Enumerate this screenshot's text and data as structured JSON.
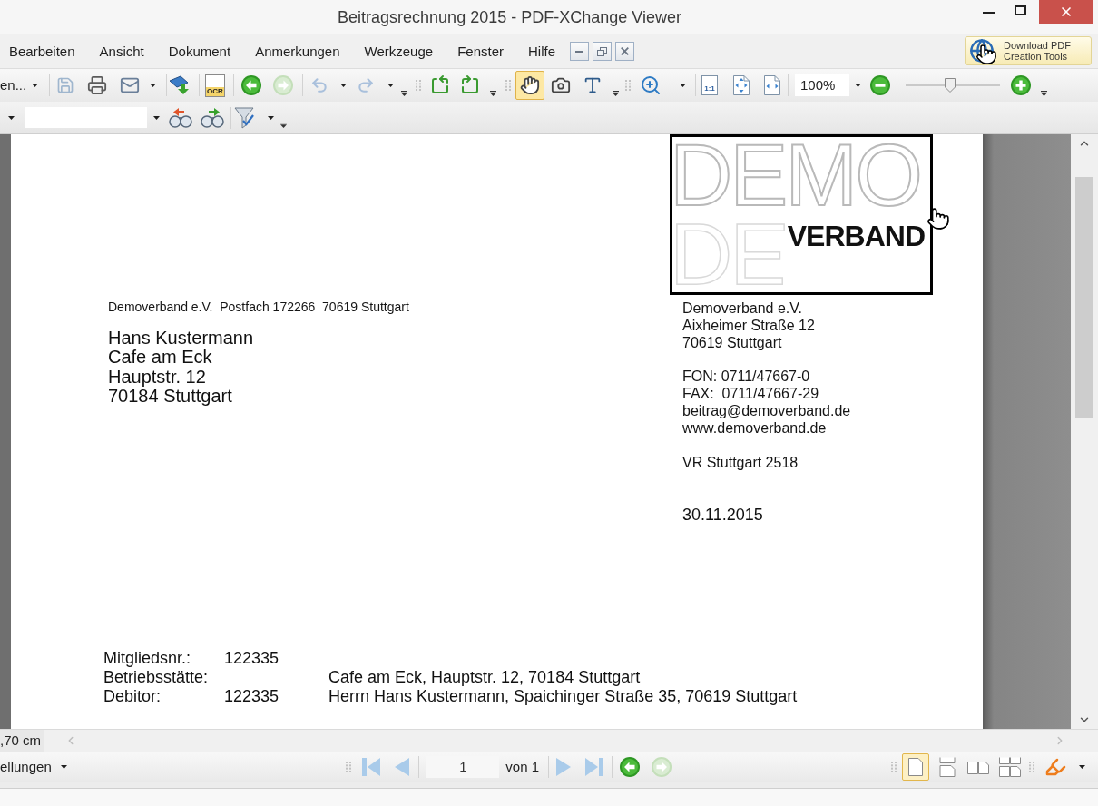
{
  "window": {
    "title": "Beitragsrechnung 2015 - PDF-XChange Viewer"
  },
  "menu": [
    "Bearbeiten",
    "Ansicht",
    "Dokument",
    "Anmerkungen",
    "Werkzeuge",
    "Fenster",
    "Hilfe"
  ],
  "download_button": {
    "lines": [
      "Download PDF",
      "Creation Tools"
    ]
  },
  "toolbar_1": {
    "open_button": {
      "label": "en..."
    },
    "save_button": {
      "disabled": true
    },
    "ocr_button": {
      "label": "OCR"
    },
    "back_button": {
      "disabled": false
    },
    "forward_button": {
      "disabled": true
    },
    "undo_button": {
      "disabled": true
    },
    "redo_button": {
      "disabled": true
    },
    "tools": [
      {
        "selected": true
      },
      {
        "selected": false
      },
      {
        "selected": false
      }
    ],
    "actual_size_button": {
      "label": "1:1"
    },
    "zoom": {
      "value": "100%",
      "level": 0.47
    }
  },
  "document": {
    "logo": {
      "word": "DEMO",
      "reflection": "DE",
      "subtitle": "VERBAND"
    },
    "sender_line": "Demoverband e.V.  Postfach 172266  70619 Stuttgart",
    "recipient": [
      "Hans Kustermann",
      "Cafe am Eck",
      "Hauptstr. 12",
      "70184 Stuttgart"
    ],
    "letterhead": [
      [
        "Demoverband e.V.",
        "Aixheimer Straße 12",
        "70619 Stuttgart"
      ],
      [
        "FON: 0711/47667-0",
        "FAX:  0711/47667-29",
        "beitrag@demoverband.de",
        "www.demoverband.de"
      ],
      [
        "VR Stuttgart 2518"
      ]
    ],
    "date": "30.11.2015",
    "details": [
      {
        "label": "Mitgliedsnr.:",
        "number": "122335"
      },
      {
        "label": "Betriebsstätte:",
        "text": "Cafe am Eck, Hauptstr. 12, 70184 Stuttgart"
      },
      {
        "label": "Debitor:",
        "number": "122335",
        "text": "Herrn Hans Kustermann, Spaichinger Straße 35, 70619 Stuttgart"
      }
    ]
  },
  "horizontal_scrollbar": {
    "reading": ",70 cm"
  },
  "status_bar": {
    "dropdown_button": {
      "label": "ellungen"
    },
    "first_page_button": {
      "disabled": true
    },
    "previous_page_button": {
      "disabled": true
    },
    "page_field": {
      "value": "1"
    },
    "page_count": "von 1",
    "next_page_button": {
      "disabled": true
    },
    "last_page_button": {
      "disabled": true
    },
    "back_button": {
      "disabled": false
    },
    "forward_button": {
      "disabled": true
    },
    "layouts": [
      {
        "selected": true
      },
      {
        "selected": false
      },
      {
        "selected": false
      },
      {
        "selected": false
      }
    ]
  }
}
